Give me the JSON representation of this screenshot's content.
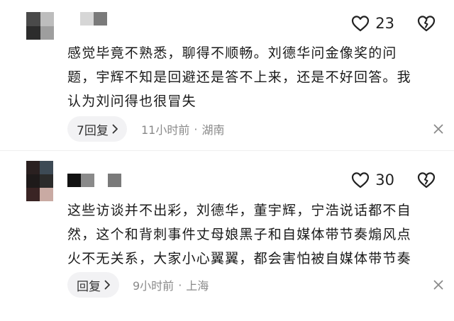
{
  "comments": [
    {
      "likes": "23",
      "text_lines": [
        "感觉毕竟不熟悉，聊得不顺畅。刘德华问金像奖的问",
        "题，宇辉不知是回避还是答不上来，还是不好回答。我",
        "认为刘问得也很冒失"
      ],
      "reply_label": "7回复",
      "time": "11小时前",
      "location": "湖南"
    },
    {
      "likes": "30",
      "text_lines": [
        "这些访谈并不出彩，刘德华，董宇辉，宁浩说话都不自",
        "然，这个和背刺事件丈母娘黑子和自媒体带节奏煽风点",
        "火不无关系，大家小心翼翼，都会害怕被自媒体带节奏"
      ],
      "reply_label": "回复",
      "time": "9小时前",
      "location": "上海"
    }
  ],
  "meta_separator": "·",
  "icons": {
    "like": "heart-icon",
    "dislike": "broken-heart-icon",
    "reply_arrow": "chevron-right-icon",
    "dismiss": "close-icon"
  },
  "colors": {
    "text": "#1a1a1a",
    "meta": "#8a8a8a",
    "reply_bg": "#f2f2f4",
    "icon": "#222222"
  }
}
